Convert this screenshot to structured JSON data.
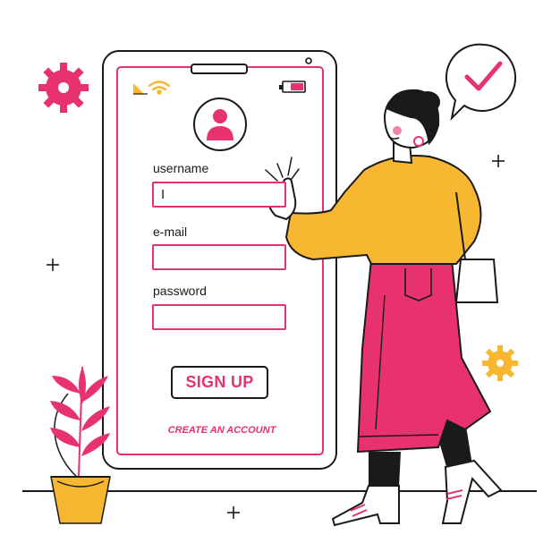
{
  "form": {
    "username_label": "username",
    "username_value": "I",
    "email_label": "e-mail",
    "email_value": "",
    "password_label": "password",
    "password_value": "",
    "signup_label": "SIGN UP",
    "create_account_label": "CREATE AN ACCOUNT"
  },
  "colors": {
    "accent_pink": "#e8326f",
    "sweater_yellow": "#f7b731",
    "outline": "#1a1a1a"
  },
  "icons": [
    "signal-icon",
    "wifi-icon",
    "battery-icon",
    "user-avatar-icon",
    "checkmark-icon",
    "gear-icon",
    "sparkle-icon"
  ]
}
